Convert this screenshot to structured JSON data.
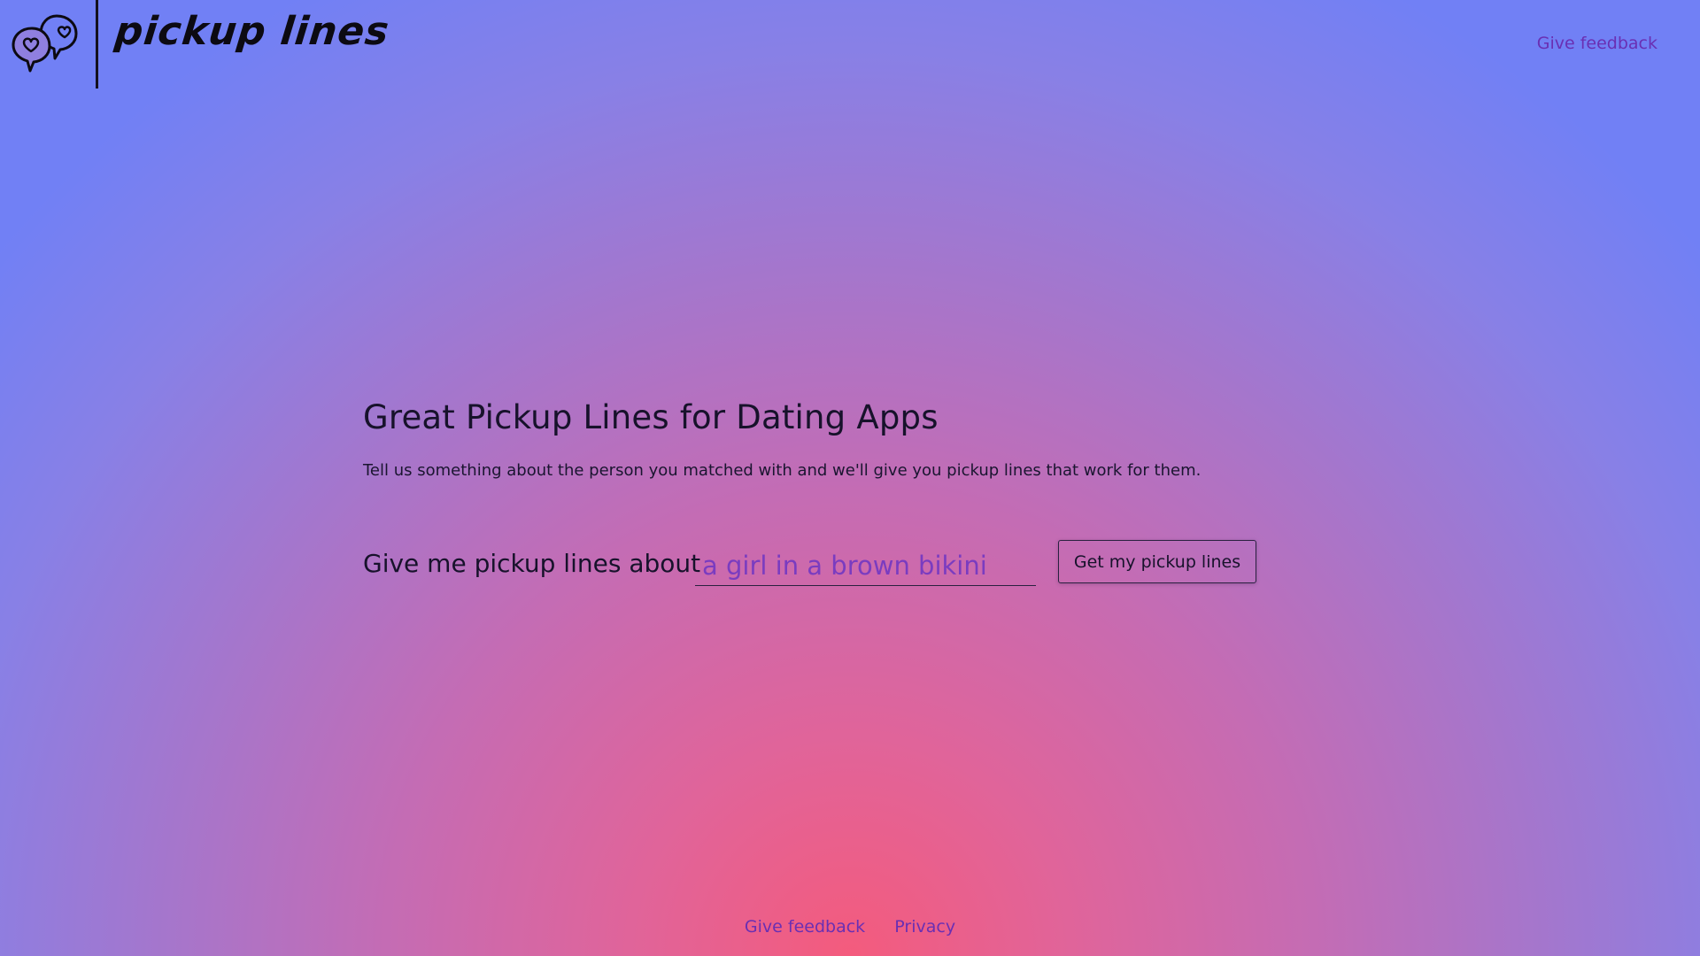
{
  "header": {
    "logo_text": "pickup lines",
    "logo_icon": "heart-speech-bubbles-icon",
    "feedback_link": "Give feedback"
  },
  "main": {
    "title": "Great Pickup Lines for Dating Apps",
    "subtitle": "Tell us something about the person you matched with and we'll give you pickup lines that work for them.",
    "form": {
      "label": "Give me pickup lines about",
      "input_value": "",
      "input_placeholder": "a girl in a brown bikini",
      "submit_label": "Get my pickup lines"
    }
  },
  "footer": {
    "links": [
      {
        "label": "Give feedback"
      },
      {
        "label": "Privacy"
      }
    ]
  },
  "colors": {
    "gradient_center": "#f45b7d",
    "gradient_edge": "#7180f5",
    "link": "#6a2fb3",
    "input_text": "#7a3cc0",
    "text": "#17122b"
  }
}
